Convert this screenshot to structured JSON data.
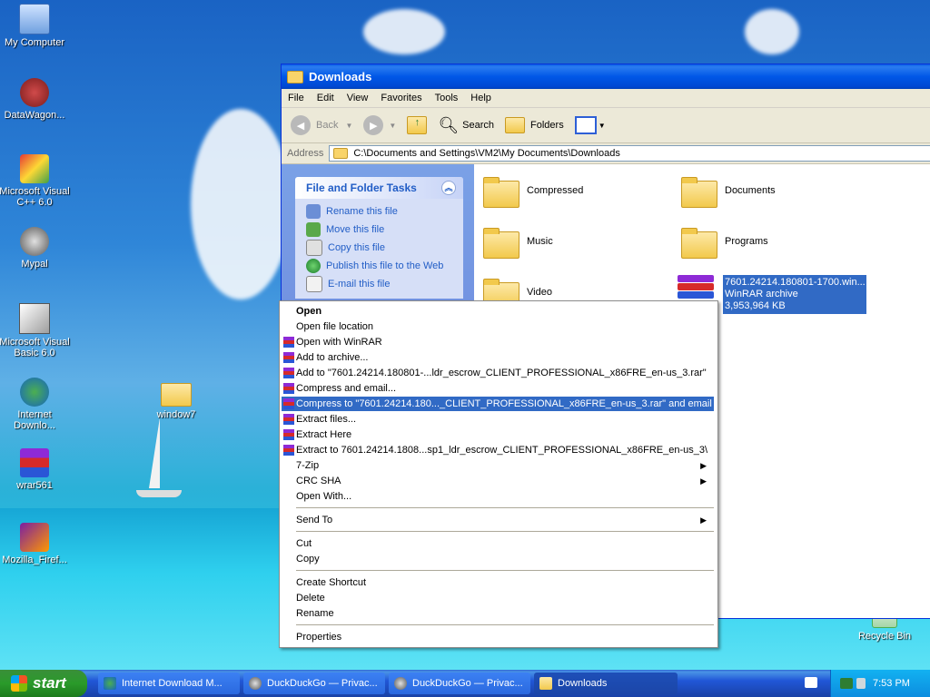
{
  "desktop": {
    "icons": [
      {
        "label": "My Computer"
      },
      {
        "label": "DataWagon..."
      },
      {
        "label": "Microsoft Visual C++ 6.0"
      },
      {
        "label": "Mypal"
      },
      {
        "label": "Microsoft Visual Basic 6.0"
      },
      {
        "label": "Internet Downlo..."
      },
      {
        "label": "window7"
      },
      {
        "label": "wrar561"
      },
      {
        "label": "Mozilla_Firef..."
      },
      {
        "label": "Recycle Bin"
      }
    ]
  },
  "window": {
    "title": "Downloads",
    "menu": [
      "File",
      "Edit",
      "View",
      "Favorites",
      "Tools",
      "Help"
    ],
    "toolbar": {
      "back": "Back",
      "search": "Search",
      "folders": "Folders"
    },
    "address_label": "Address",
    "address_value": "C:\\Documents and Settings\\VM2\\My Documents\\Downloads",
    "tasks_header": "File and Folder Tasks",
    "tasks": [
      "Rename this file",
      "Move this file",
      "Copy this file",
      "Publish this file to the Web",
      "E-mail this file"
    ],
    "items": {
      "compressed": "Compressed",
      "documents": "Documents",
      "music": "Music",
      "programs": "Programs",
      "video": "Video",
      "archive_name": "7601.24214.180801-1700.win...",
      "archive_type": "WinRAR archive",
      "archive_size": "3,953,964 KB"
    }
  },
  "context_menu": {
    "open": "Open",
    "open_location": "Open file location",
    "open_winrar": "Open with WinRAR",
    "add_archive": "Add to archive...",
    "add_to": "Add to \"7601.24214.180801-...ldr_escrow_CLIENT_PROFESSIONAL_x86FRE_en-us_3.rar\"",
    "compress_email": "Compress and email...",
    "compress_to_email": "Compress to \"7601.24214.180..._CLIENT_PROFESSIONAL_x86FRE_en-us_3.rar\" and email",
    "extract_files": "Extract files...",
    "extract_here": "Extract Here",
    "extract_to": "Extract to 7601.24214.1808...sp1_ldr_escrow_CLIENT_PROFESSIONAL_x86FRE_en-us_3\\",
    "seven_zip": "7-Zip",
    "crc_sha": "CRC SHA",
    "open_with": "Open With...",
    "send_to": "Send To",
    "cut": "Cut",
    "copy": "Copy",
    "create_shortcut": "Create Shortcut",
    "delete": "Delete",
    "rename": "Rename",
    "properties": "Properties"
  },
  "taskbar": {
    "start": "start",
    "buttons": [
      "Internet Download M...",
      "DuckDuckGo — Privac...",
      "DuckDuckGo — Privac...",
      "Downloads"
    ],
    "clock": "7:53 PM"
  }
}
